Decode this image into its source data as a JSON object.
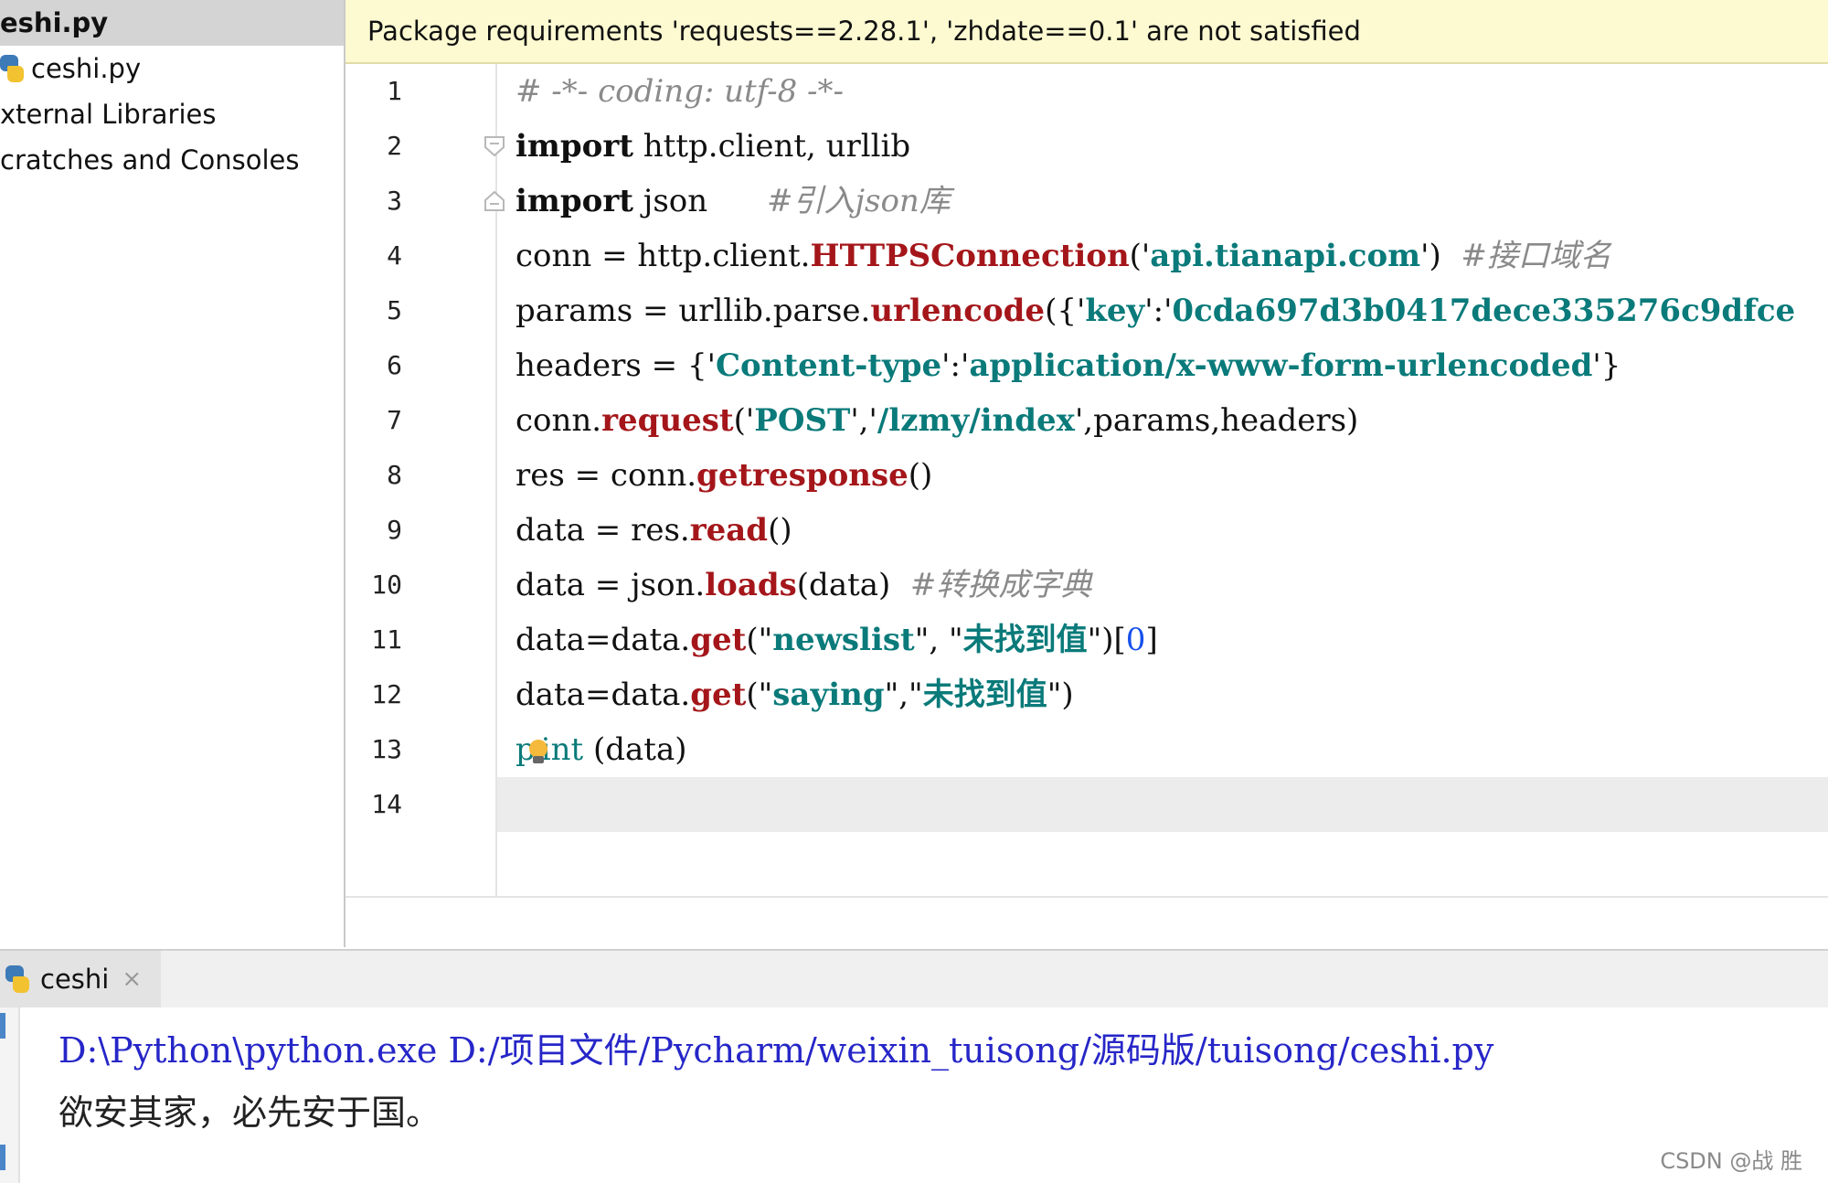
{
  "project_tree": {
    "items": [
      {
        "label": "eshi.py",
        "selected": true,
        "icon": null
      },
      {
        "label": "ceshi.py",
        "selected": false,
        "icon": "python-file-icon"
      },
      {
        "label": "xternal Libraries",
        "selected": false,
        "icon": null
      },
      {
        "label": "cratches and Consoles",
        "selected": false,
        "icon": null
      }
    ]
  },
  "editor": {
    "banner_text": "Package requirements 'requests==2.28.1', 'zhdate==0.1' are not satisfied",
    "line_numbers": [
      "1",
      "2",
      "3",
      "4",
      "5",
      "6",
      "7",
      "8",
      "9",
      "10",
      "11",
      "12",
      "13",
      "14"
    ],
    "lines": [
      [
        {
          "t": "# -*- coding: utf-8 -*-",
          "c": "cm"
        }
      ],
      [
        {
          "t": "import",
          "c": "kw"
        },
        {
          "t": " http.client, urllib",
          "c": "plain"
        }
      ],
      [
        {
          "t": "import",
          "c": "kw"
        },
        {
          "t": " json      ",
          "c": "plain"
        },
        {
          "t": "#引入json库",
          "c": "cm"
        }
      ],
      [
        {
          "t": "conn = http.client.",
          "c": "plain"
        },
        {
          "t": "HTTPSConnection",
          "c": "fn"
        },
        {
          "t": "('",
          "c": "plain"
        },
        {
          "t": "api.tianapi.com",
          "c": "str"
        },
        {
          "t": "')  ",
          "c": "plain"
        },
        {
          "t": "#接口域名",
          "c": "cm"
        }
      ],
      [
        {
          "t": "params = urllib.parse.",
          "c": "plain"
        },
        {
          "t": "urlencode",
          "c": "fn"
        },
        {
          "t": "({'",
          "c": "plain"
        },
        {
          "t": "key",
          "c": "str"
        },
        {
          "t": "':'",
          "c": "plain"
        },
        {
          "t": "0cda697d3b0417dece335276c9dfce",
          "c": "str"
        }
      ],
      [
        {
          "t": "headers = {'",
          "c": "plain"
        },
        {
          "t": "Content-type",
          "c": "str"
        },
        {
          "t": "':'",
          "c": "plain"
        },
        {
          "t": "application/x-www-form-urlencoded",
          "c": "str"
        },
        {
          "t": "'}",
          "c": "plain"
        }
      ],
      [
        {
          "t": "conn.",
          "c": "plain"
        },
        {
          "t": "request",
          "c": "fn"
        },
        {
          "t": "('",
          "c": "plain"
        },
        {
          "t": "POST",
          "c": "str"
        },
        {
          "t": "','",
          "c": "plain"
        },
        {
          "t": "/lzmy/index",
          "c": "str"
        },
        {
          "t": "',params,headers)",
          "c": "plain"
        }
      ],
      [
        {
          "t": "res = conn.",
          "c": "plain"
        },
        {
          "t": "getresponse",
          "c": "fn"
        },
        {
          "t": "()",
          "c": "plain"
        }
      ],
      [
        {
          "t": "data = res.",
          "c": "plain"
        },
        {
          "t": "read",
          "c": "fn"
        },
        {
          "t": "()",
          "c": "plain"
        }
      ],
      [
        {
          "t": "data = json.",
          "c": "plain"
        },
        {
          "t": "loads",
          "c": "fn"
        },
        {
          "t": "(data)  ",
          "c": "plain"
        },
        {
          "t": "#转换成字典",
          "c": "cm"
        }
      ],
      [
        {
          "t": "data=data.",
          "c": "plain"
        },
        {
          "t": "get",
          "c": "fn"
        },
        {
          "t": "(\"",
          "c": "plain"
        },
        {
          "t": "newslist",
          "c": "str"
        },
        {
          "t": "\", \"",
          "c": "plain"
        },
        {
          "t": "未找到值",
          "c": "str"
        },
        {
          "t": "\")[",
          "c": "plain"
        },
        {
          "t": "0",
          "c": "num"
        },
        {
          "t": "]",
          "c": "plain"
        }
      ],
      [
        {
          "t": "data=data.",
          "c": "plain"
        },
        {
          "t": "get",
          "c": "fn"
        },
        {
          "t": "(\"",
          "c": "plain"
        },
        {
          "t": "saying",
          "c": "str"
        },
        {
          "t": "\",\"",
          "c": "plain"
        },
        {
          "t": "未找到值",
          "c": "str"
        },
        {
          "t": "\")",
          "c": "plain"
        }
      ],
      [
        {
          "t": "p",
          "c": "builtin"
        },
        {
          "t": "BULB",
          "c": "bulb"
        },
        {
          "t": "int",
          "c": "builtin"
        },
        {
          "t": " (data)",
          "c": "plain"
        }
      ],
      []
    ],
    "fold_marker_lines": [
      2,
      3
    ],
    "current_line": 14
  },
  "run_panel": {
    "tab_label": "ceshi",
    "tab_close": "×",
    "output_lines": [
      "D:\\Python\\python.exe D:/项目文件/Pycharm/weixin_tuisong/源码版/tuisong/ceshi.py",
      "欲安其家，必先安于国。"
    ],
    "watermark": "CSDN @战 胜"
  },
  "colors": {
    "banner_bg": "#fdfad2",
    "keyword": "#101010",
    "function_call": "#a4161a",
    "string": "#0a7a7a",
    "comment": "#8a8a8a",
    "console_path": "#2626c8"
  }
}
